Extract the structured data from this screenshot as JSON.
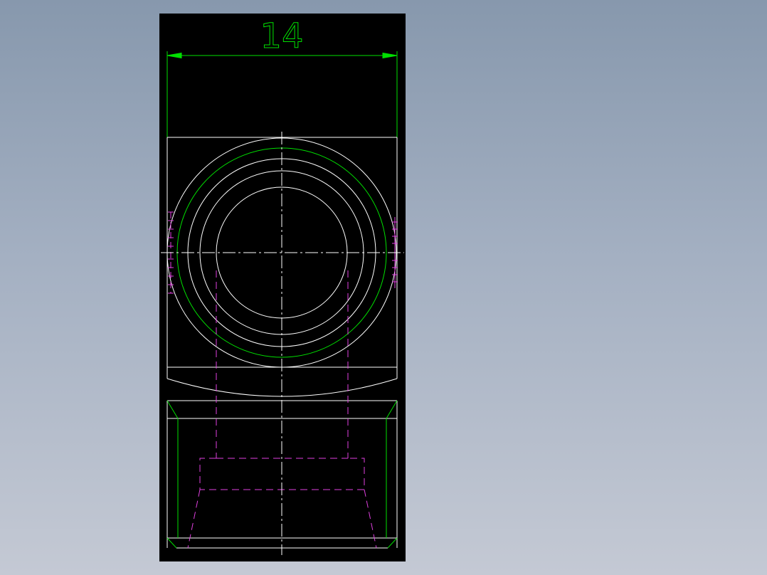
{
  "dimension": {
    "value": "14"
  },
  "colors": {
    "background_top": "#8798ad",
    "background_bottom": "#c4c9d4",
    "canvas": "#000000",
    "outline": "#ffffff",
    "dimension": "#00e000",
    "hidden": "#e040e0"
  }
}
